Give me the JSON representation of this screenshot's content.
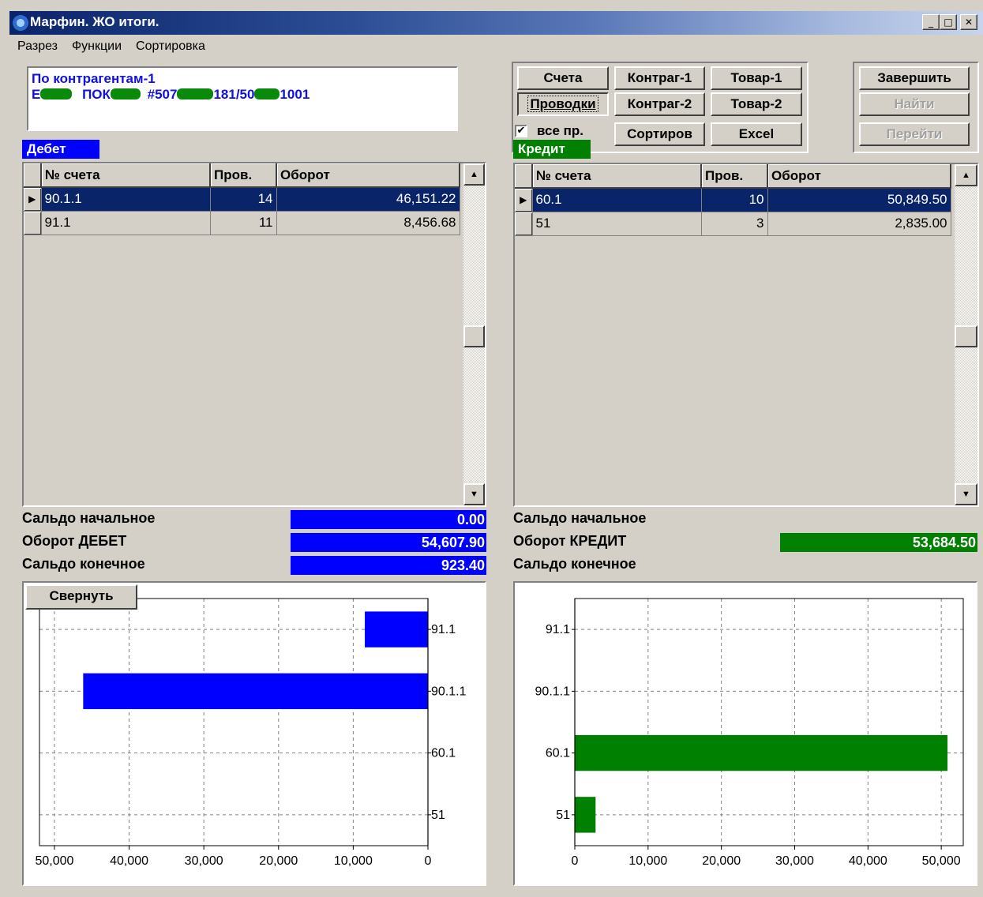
{
  "window": {
    "title": "Марфин. ЖО итоги.",
    "min": "_",
    "max": "□",
    "close": "✕"
  },
  "menu": [
    "Разрез",
    "Функции",
    "Сортировка"
  ],
  "info": {
    "line1": "По контрагентам-1",
    "line2a": "Е",
    "line2b": "ПОК",
    "line2c": "#507",
    "line2d": "181/50",
    "line2e": "1001"
  },
  "buttons": {
    "scheta": "Счета",
    "kontrag1": "Контраг-1",
    "tovar1": "Товар-1",
    "provodki": "Проводки",
    "kontrag2": "Контраг-2",
    "tovar2": "Товар-2",
    "sortirov": "Сортиров",
    "excel": "Excel",
    "finish": "Завершить",
    "find": "Найти",
    "goto": "Перейти",
    "collapse": "Свернуть"
  },
  "all_checkbox": {
    "label": "все пр.",
    "checked": true
  },
  "debit": {
    "label": "Дебет",
    "color": "#0000ff",
    "columns": [
      "№ счета",
      "Пров.",
      "Оборот"
    ],
    "rows": [
      {
        "account": "90.1.1",
        "count": "14",
        "turnover": "46,151.22",
        "selected": true
      },
      {
        "account": "91.1",
        "count": "11",
        "turnover": "8,456.68",
        "selected": false
      }
    ],
    "summary": [
      {
        "label": "Сальдо начальное",
        "value": "0.00"
      },
      {
        "label": "Оборот ДЕБЕТ",
        "value": "54,607.90"
      },
      {
        "label": "Сальдо конечное",
        "value": "923.40"
      }
    ]
  },
  "credit": {
    "label": "Кредит",
    "color": "#008000",
    "columns": [
      "№ счета",
      "Пров.",
      "Оборот"
    ],
    "rows": [
      {
        "account": "60.1",
        "count": "10",
        "turnover": "50,849.50",
        "selected": true
      },
      {
        "account": "51",
        "count": "3",
        "turnover": "2,835.00",
        "selected": false
      }
    ],
    "summary": [
      {
        "label": "Сальдо начальное",
        "value": ""
      },
      {
        "label": "Оборот КРЕДИТ",
        "value": "53,684.50"
      },
      {
        "label": "Сальдо конечное",
        "value": ""
      }
    ]
  },
  "chart_data": [
    {
      "type": "bar",
      "orientation": "horizontal",
      "x_reversed": true,
      "categories": [
        "91.1",
        "90.1.1",
        "60.1",
        "51"
      ],
      "values": [
        8456.68,
        46151.22,
        0,
        0
      ],
      "color": "#0000ff",
      "xlim": [
        0,
        52000
      ],
      "xticks": [
        "50,000",
        "40,000",
        "30,000",
        "20,000",
        "10,000",
        "0"
      ],
      "xtick_values": [
        50000,
        40000,
        30000,
        20000,
        10000,
        0
      ],
      "grid": true
    },
    {
      "type": "bar",
      "orientation": "horizontal",
      "x_reversed": false,
      "categories": [
        "91.1",
        "90.1.1",
        "60.1",
        "51"
      ],
      "values": [
        0,
        0,
        50849.5,
        2835
      ],
      "color": "#008000",
      "xlim": [
        0,
        53000
      ],
      "xticks": [
        "0",
        "10,000",
        "20,000",
        "30,000",
        "40,000",
        "50,000"
      ],
      "xtick_values": [
        0,
        10000,
        20000,
        30000,
        40000,
        50000
      ],
      "grid": true
    }
  ]
}
